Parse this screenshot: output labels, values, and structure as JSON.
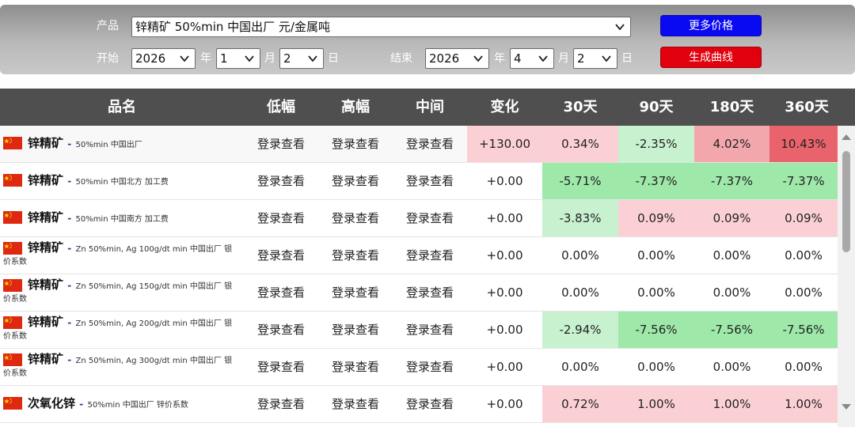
{
  "filter": {
    "product_label": "产品",
    "product_value": "锌精矿 50%min 中国出厂 元/金属吨",
    "start_label": "开始",
    "end_label": "结束",
    "year_unit": "年",
    "month_unit": "月",
    "day_unit": "日",
    "start": {
      "year": "2026",
      "month": "1",
      "day": "2"
    },
    "end": {
      "year": "2026",
      "month": "4",
      "day": "2"
    },
    "more_prices_button": "更多价格",
    "generate_curve_button": "生成曲线"
  },
  "table": {
    "headers": [
      "品名",
      "低幅",
      "高幅",
      "中间",
      "变化",
      "30天",
      "90天",
      "180天",
      "360天"
    ],
    "rows": [
      {
        "name": "锌精矿",
        "spec": "50%min 中国出厂",
        "spec2": "",
        "low": "登录查看",
        "high": "登录查看",
        "mid": "登录查看",
        "change": "+130.00",
        "d30": "0.34%",
        "d90": "-2.35%",
        "d180": "4.02%",
        "d360": "10.43%"
      },
      {
        "name": "锌精矿",
        "spec": "50%min 中国北方 加工费",
        "spec2": "",
        "low": "登录查看",
        "high": "登录查看",
        "mid": "登录查看",
        "change": "+0.00",
        "d30": "-5.71%",
        "d90": "-7.37%",
        "d180": "-7.37%",
        "d360": "-7.37%"
      },
      {
        "name": "锌精矿",
        "spec": "50%min 中国南方 加工费",
        "spec2": "",
        "low": "登录查看",
        "high": "登录查看",
        "mid": "登录查看",
        "change": "+0.00",
        "d30": "-3.83%",
        "d90": "0.09%",
        "d180": "0.09%",
        "d360": "0.09%"
      },
      {
        "name": "锌精矿",
        "spec": "Zn 50%min, Ag 100g/dt min 中国出厂 银",
        "spec2": "价系数",
        "low": "登录查看",
        "high": "登录查看",
        "mid": "登录查看",
        "change": "+0.00",
        "d30": "0.00%",
        "d90": "0.00%",
        "d180": "0.00%",
        "d360": "0.00%"
      },
      {
        "name": "锌精矿",
        "spec": "Zn 50%min, Ag 150g/dt min 中国出厂 银",
        "spec2": "价系数",
        "low": "登录查看",
        "high": "登录查看",
        "mid": "登录查看",
        "change": "+0.00",
        "d30": "0.00%",
        "d90": "0.00%",
        "d180": "0.00%",
        "d360": "0.00%"
      },
      {
        "name": "锌精矿",
        "spec": "Zn 50%min, Ag 200g/dt min 中国出厂 银",
        "spec2": "价系数",
        "low": "登录查看",
        "high": "登录查看",
        "mid": "登录查看",
        "change": "+0.00",
        "d30": "-2.94%",
        "d90": "-7.56%",
        "d180": "-7.56%",
        "d360": "-7.56%"
      },
      {
        "name": "锌精矿",
        "spec": "Zn 50%min, Ag 300g/dt min 中国出厂 银",
        "spec2": "价系数",
        "low": "登录查看",
        "high": "登录查看",
        "mid": "登录查看",
        "change": "+0.00",
        "d30": "0.00%",
        "d90": "0.00%",
        "d180": "0.00%",
        "d360": "0.00%"
      },
      {
        "name": "次氧化锌",
        "spec": "50%min 中国出厂 锌价系数",
        "spec2": "",
        "low": "登录查看",
        "high": "登录查看",
        "mid": "登录查看",
        "change": "+0.00",
        "d30": "0.72%",
        "d90": "1.00%",
        "d180": "1.00%",
        "d360": "1.00%"
      }
    ]
  },
  "colors": {
    "up_light": "#fbd0d4",
    "up_mid": "#f2a7ad",
    "up_strong": "#e8636b",
    "down_light": "#c8f2cf",
    "down_mid": "#9ee8a9",
    "header_bg": "#4f4f4f",
    "more_prices_button": "#0a0af2",
    "generate_curve_button": "#e0000e"
  },
  "icons": {
    "flag": "china-flag-icon",
    "dropdown": "chevron-down-icon",
    "scroll_up": "scroll-up-arrow-icon",
    "scroll_down": "scroll-down-arrow-icon"
  }
}
